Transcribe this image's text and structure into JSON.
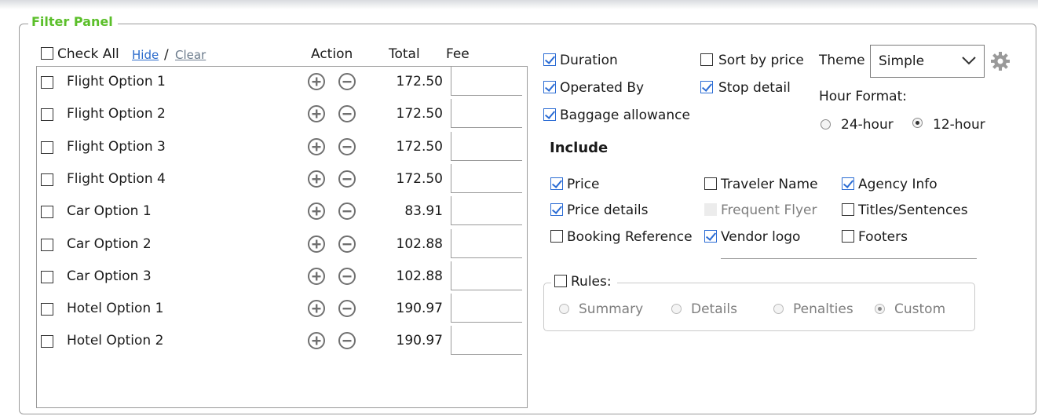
{
  "panel": {
    "title": "Filter Panel"
  },
  "list": {
    "check_all_label": "Check All",
    "hide_link": "Hide",
    "separator": "/",
    "clear_link": "Clear",
    "headers": {
      "action": "Action",
      "total": "Total",
      "fee": "Fee"
    },
    "rows": [
      {
        "name": "Flight Option 1",
        "total": "172.50"
      },
      {
        "name": "Flight Option 2",
        "total": "172.50"
      },
      {
        "name": "Flight Option 3",
        "total": "172.50"
      },
      {
        "name": "Flight Option 4",
        "total": "172.50"
      },
      {
        "name": "Car Option 1",
        "total": "83.91"
      },
      {
        "name": "Car Option 2",
        "total": "102.88"
      },
      {
        "name": "Car Option 3",
        "total": "102.88"
      },
      {
        "name": "Hotel Option 1",
        "total": "190.97"
      },
      {
        "name": "Hotel Option 2",
        "total": "190.97"
      }
    ]
  },
  "options": {
    "duration": "Duration",
    "operated_by": "Operated By",
    "baggage": "Baggage allowance",
    "sort_by_price": "Sort by price",
    "stop_detail": "Stop detail",
    "theme_label": "Theme",
    "theme_value": "Simple",
    "hour_format_label": "Hour Format:",
    "hour_24": "24-hour",
    "hour_12": "12-hour"
  },
  "include": {
    "heading": "Include",
    "price": "Price",
    "price_details": "Price details",
    "booking_reference": "Booking Reference",
    "traveler_name": "Traveler Name",
    "frequent_flyer": "Frequent Flyer",
    "vendor_logo": "Vendor logo",
    "agency_info": "Agency Info",
    "titles_sentences": "Titles/Sentences",
    "footers": "Footers"
  },
  "rules": {
    "label": "Rules:",
    "summary": "Summary",
    "details": "Details",
    "penalties": "Penalties",
    "custom": "Custom"
  },
  "colors": {
    "accent": "#5bbf2a",
    "link": "#2a6acb",
    "check": "#2b6cd4"
  },
  "icons": {
    "add": "plus-circle-icon",
    "remove": "minus-circle-icon",
    "settings": "gear-icon",
    "dropdown": "chevron-down-icon"
  }
}
